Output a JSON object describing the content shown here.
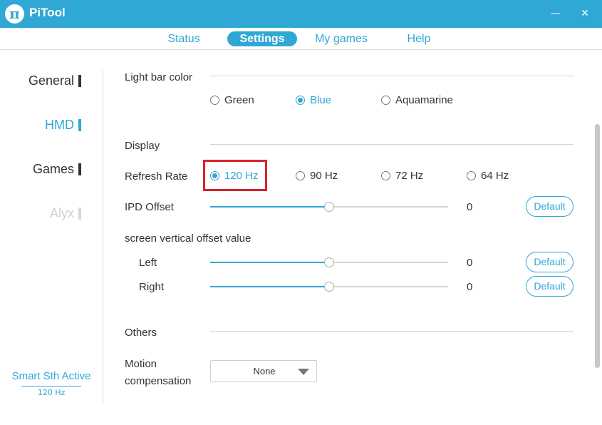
{
  "window": {
    "title": "PiTool",
    "logo_glyph": "π",
    "minimize_glyph": "—",
    "close_glyph": "✕"
  },
  "nav": {
    "tabs": [
      {
        "label": "Status",
        "active": false
      },
      {
        "label": "Settings",
        "active": true
      },
      {
        "label": "My games",
        "active": false
      },
      {
        "label": "Help",
        "active": false
      }
    ]
  },
  "sidebar": {
    "items": [
      {
        "label": "General",
        "state": "normal"
      },
      {
        "label": "HMD",
        "state": "active"
      },
      {
        "label": "Games",
        "state": "normal"
      },
      {
        "label": "Alyx",
        "state": "disabled"
      }
    ],
    "smart_smoothing": {
      "label": "Smart Sth Active",
      "rate": "120 Hz"
    }
  },
  "light_bar": {
    "section_title": "Light bar color",
    "options": [
      {
        "label": "Green",
        "selected": false
      },
      {
        "label": "Blue",
        "selected": true
      },
      {
        "label": "Aquamarine",
        "selected": false
      }
    ]
  },
  "display": {
    "section_title": "Display",
    "refresh_rate": {
      "label": "Refresh Rate",
      "options": [
        {
          "label": "120 Hz",
          "selected": true
        },
        {
          "label": "90 Hz",
          "selected": false
        },
        {
          "label": "72 Hz",
          "selected": false
        },
        {
          "label": "64 Hz",
          "selected": false
        }
      ],
      "highlight_color": "#d9232b"
    },
    "ipd_offset": {
      "label": "IPD Offset",
      "value": "0",
      "slider_fraction": 0.5,
      "default_label": "Default"
    },
    "vertical_offset": {
      "title": "screen vertical offset value",
      "left": {
        "label": "Left",
        "value": "0",
        "slider_fraction": 0.5,
        "default_label": "Default"
      },
      "right": {
        "label": "Right",
        "value": "0",
        "slider_fraction": 0.5,
        "default_label": "Default"
      }
    }
  },
  "others": {
    "section_title": "Others",
    "motion_compensation": {
      "label_line1": "Motion",
      "label_line2": "compensation",
      "selected": "None"
    }
  },
  "colors": {
    "accent": "#2fa8d5",
    "titlebar": "#2fa8d5",
    "text": "#333333",
    "disabled": "#cfcfcf"
  },
  "icons": {
    "logo": "pi-logo-icon",
    "minimize": "minimize-icon",
    "close": "close-icon",
    "dropdown": "chevron-down-icon"
  }
}
